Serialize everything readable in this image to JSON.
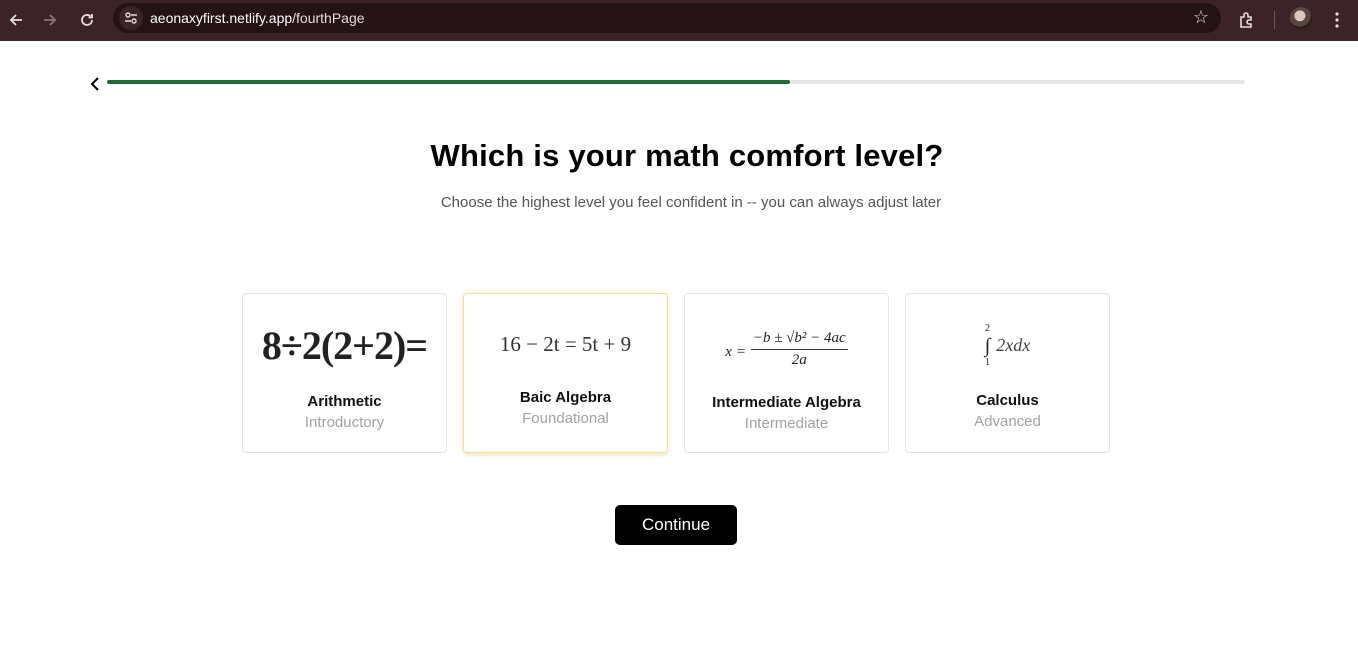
{
  "browser": {
    "url_host": "aeonaxyfirst.netlify.app",
    "url_path": "/fourthPage"
  },
  "progress": {
    "fraction": 0.6
  },
  "question": {
    "title": "Which is your math comfort level?",
    "subtitle": "Choose the highest level you feel confident in -- you can always adjust later"
  },
  "options": [
    {
      "name": "Arithmetic",
      "level": "Introductory",
      "formula": "8÷2(2+2)="
    },
    {
      "name": "Baic Algebra",
      "level": "Foundational",
      "formula": "16 − 2t = 5t + 9"
    },
    {
      "name": "Intermediate Algebra",
      "level": "Intermediate",
      "formula_lhs": "x =",
      "formula_num": "−b ± √b² − 4ac",
      "formula_den": "2a"
    },
    {
      "name": "Calculus",
      "level": "Advanced",
      "formula_upper": "2",
      "formula_lower": "1",
      "formula_body": "2xdx"
    }
  ],
  "selected_option": "Baic Algebra",
  "continue_label": "Continue",
  "colors": {
    "chrome_bg": "#3b2327",
    "progress": "#1f6b3a",
    "selected_border": "#f2e28b",
    "button_bg": "#000000"
  }
}
